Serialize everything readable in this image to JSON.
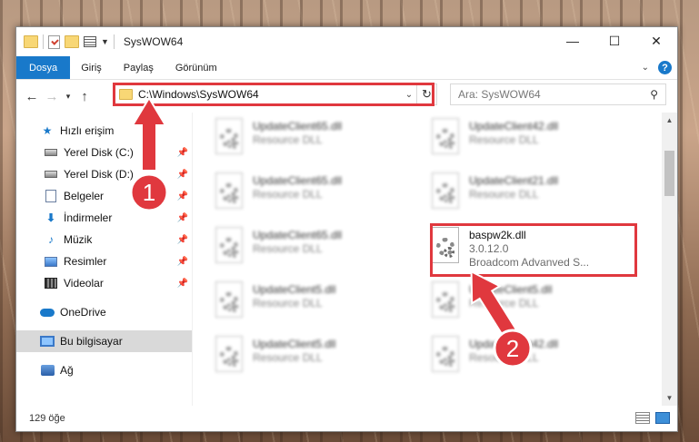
{
  "window": {
    "title": "SysWOW64",
    "controls": {
      "minimize": "—",
      "maximize": "☐",
      "close": "✕"
    }
  },
  "ribbon": {
    "tabs": [
      "Dosya",
      "Giriş",
      "Paylaş",
      "Görünüm"
    ]
  },
  "navigation": {
    "address_path": "C:\\Windows\\SysWOW64",
    "search_placeholder": "Ara: SysWOW64"
  },
  "sidebar": {
    "quick_access": "Hızlı erişim",
    "items": [
      {
        "label": "Yerel Disk (C:)",
        "icon": "drive-icon"
      },
      {
        "label": "Yerel Disk (D:)",
        "icon": "drive-icon"
      },
      {
        "label": "Belgeler",
        "icon": "document-icon"
      },
      {
        "label": "İndirmeler",
        "icon": "download-icon"
      },
      {
        "label": "Müzik",
        "icon": "music-icon"
      },
      {
        "label": "Resimler",
        "icon": "pictures-icon"
      },
      {
        "label": "Videolar",
        "icon": "video-icon"
      }
    ],
    "onedrive": "OneDrive",
    "this_pc": "Bu bilgisayar",
    "network": "Ağ"
  },
  "files": [
    {
      "name": "UpdateClient65.dll",
      "sub": "Resource DLL",
      "blurred": true
    },
    {
      "name": "UpdateClient42.dll",
      "sub": "Resource DLL",
      "blurred": true
    },
    {
      "name": "UpdateClient65.dll",
      "sub": "Resource DLL",
      "blurred": true
    },
    {
      "name": "UpdateClient21.dll",
      "sub": "Resource DLL",
      "blurred": true
    },
    {
      "name": "UpdateClient65.dll",
      "sub": "Resource DLL",
      "blurred": true
    },
    {
      "name": "UpdateClient65.dll",
      "sub": "Resource DLL",
      "blurred": true
    },
    {
      "name": "baspw2k.dll",
      "version": "3.0.12.0",
      "sub": "Broadcom Advanved S...",
      "blurred": false
    },
    {
      "name": "UpdateClient5.dll",
      "sub": "Resource DLL",
      "blurred": true
    },
    {
      "name": "UpdateClient5.dll",
      "sub": "Resource DLL",
      "blurred": true
    },
    {
      "name": "UpdateClient5.dll",
      "sub": "Resource DLL",
      "blurred": true
    },
    {
      "name": "UpdateClient42.dll",
      "sub": "Resource DLL",
      "blurred": true
    }
  ],
  "status": {
    "item_count": "129 öğe"
  },
  "callouts": {
    "one": "1",
    "two": "2"
  },
  "colors": {
    "accent": "#1979ca",
    "highlight": "#e0383e"
  }
}
